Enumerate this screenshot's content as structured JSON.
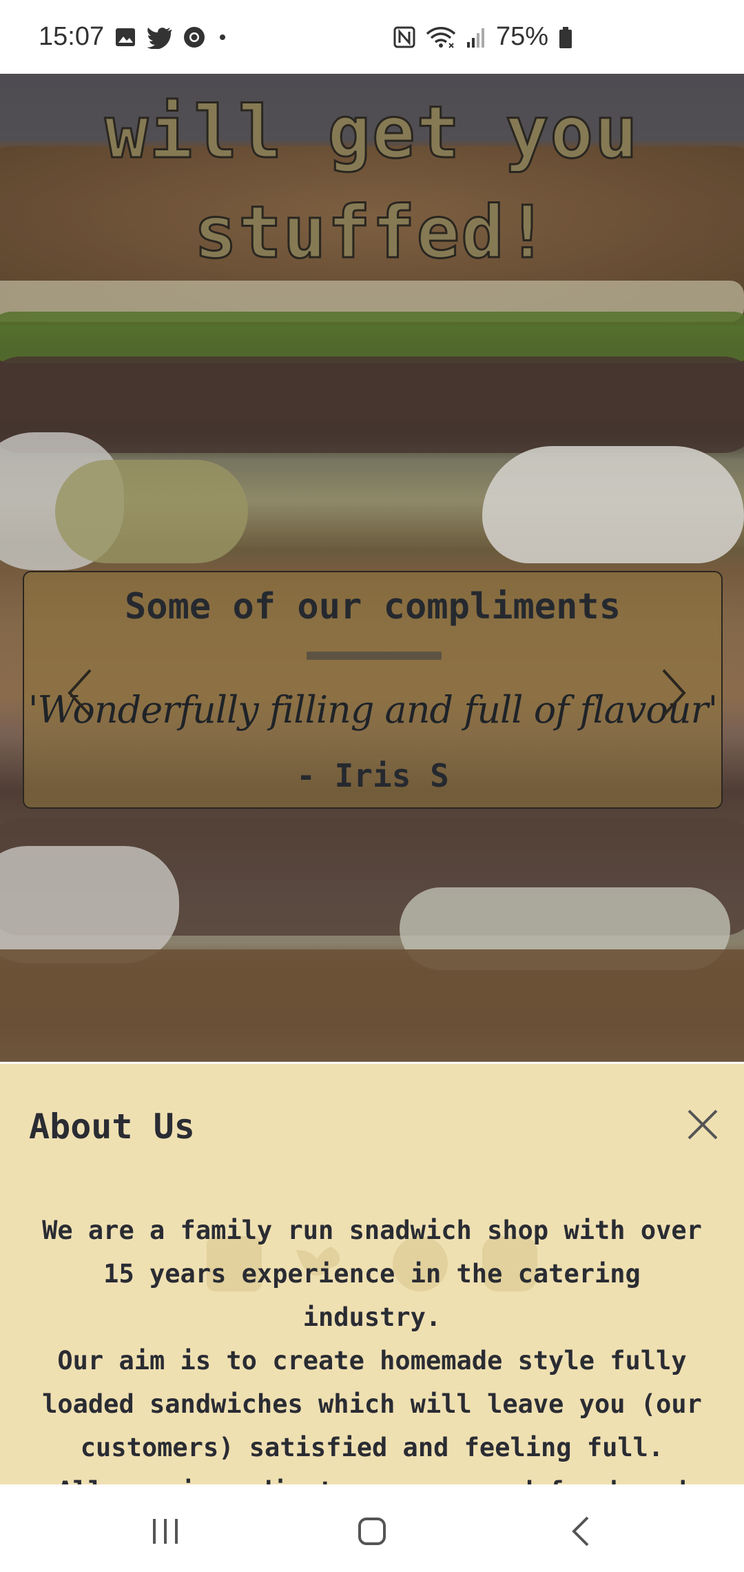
{
  "status_bar": {
    "time": "15:07",
    "left_icons": [
      "gallery-icon",
      "twitter-icon",
      "chrome-icon",
      "dot-icon"
    ],
    "right_icons": [
      "nfc-icon",
      "wifi-icon",
      "signal-icon"
    ],
    "battery": "75%"
  },
  "hero": {
    "headline_line1": "will get you",
    "headline_line2": "stuffed!"
  },
  "testimonial": {
    "title": "Some of our compliments",
    "quote": "'Wonderfully filling and full of flavour'",
    "author": "- Iris S",
    "prev_icon": "chevron-left-icon",
    "next_icon": "chevron-right-icon"
  },
  "about": {
    "title": "About Us",
    "close_icon": "close-icon",
    "paragraph1": "We are a family run snadwich shop with over 15 years experience in the catering industry.",
    "paragraph2": "Our aim is to create homemade style fully loaded sandwiches which will leave you (our customers) satisfied and feeling full.",
    "paragraph3": "All our ingredients are sourced fresh and locally"
  },
  "nav_bar": {
    "icons": [
      "recent-apps-icon",
      "home-icon",
      "back-icon"
    ]
  },
  "colors": {
    "about_bg": "#efe0b2",
    "text_dark": "#2a2c33",
    "headline": "#857a54"
  }
}
